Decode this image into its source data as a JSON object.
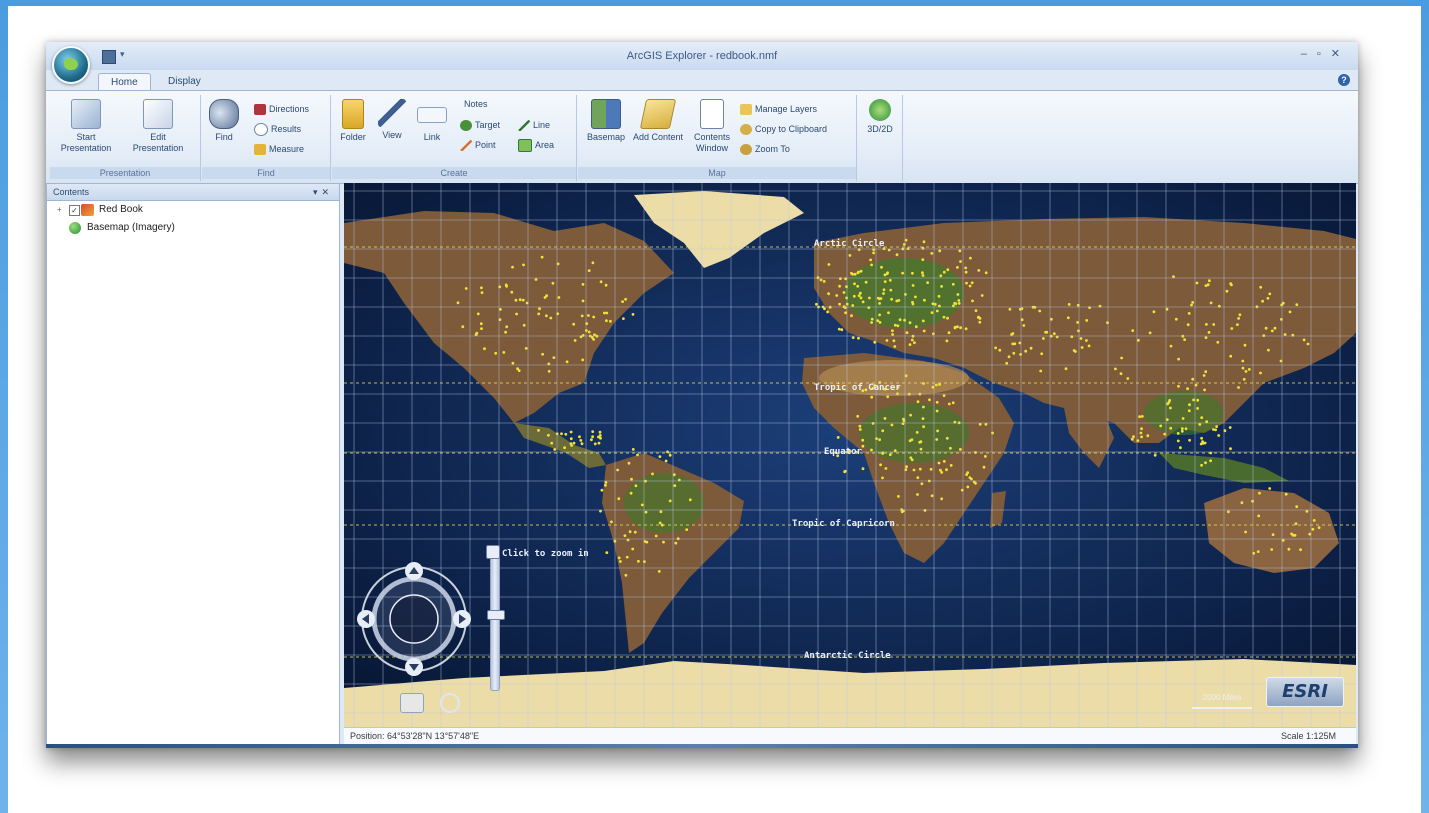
{
  "window": {
    "title": "ArcGIS Explorer - redbook.nmf"
  },
  "tabs": [
    {
      "label": "Home",
      "active": true
    },
    {
      "label": "Display",
      "active": false
    }
  ],
  "ribbon": {
    "presentation": {
      "label": "Presentation",
      "start": "Start Presentation",
      "edit": "Edit Presentation"
    },
    "find": {
      "label": "Find",
      "find_btn": "Find",
      "directions": "Directions",
      "results": "Results",
      "measure": "Measure"
    },
    "create": {
      "label": "Create",
      "folder": "Folder",
      "view": "View",
      "link": "Link",
      "notes_header": "Notes",
      "target": "Target",
      "line": "Line",
      "point": "Point",
      "area": "Area"
    },
    "map": {
      "label": "Map",
      "basemap": "Basemap",
      "add_content": "Add Content",
      "contents_window": "Contents Window",
      "manage_layers": "Manage Layers",
      "copy_clipboard": "Copy to Clipboard",
      "zoom_to": "Zoom To"
    },
    "extra": {
      "btn": "3D/2D"
    }
  },
  "contents": {
    "header": "Contents",
    "items": [
      {
        "label": "Red Book",
        "checked": true
      },
      {
        "label": "Basemap (Imagery)",
        "checked": false
      }
    ]
  },
  "map": {
    "labels": {
      "arctic": "Arctic Circle",
      "tropic_cancer": "Tropic of Cancer",
      "equator": "Equator",
      "tropic_capricorn": "Tropic of Capricorn",
      "antarctic": "Antarctic Circle",
      "click_zoom": "Click to zoom in"
    },
    "scale_text": "2000 Miles",
    "logo": "ESRI"
  },
  "status": {
    "coords": "Position: 64°53'28\"N  13°57'48\"E",
    "scale": "Scale 1:125M"
  },
  "colors": {
    "ocean": "#0e2a5a",
    "land": "#7c5a3a",
    "ice": "#ecdca8",
    "grid": "#b9c9e6",
    "points": "#f2e237",
    "vegetation": "#3f7a2a"
  }
}
